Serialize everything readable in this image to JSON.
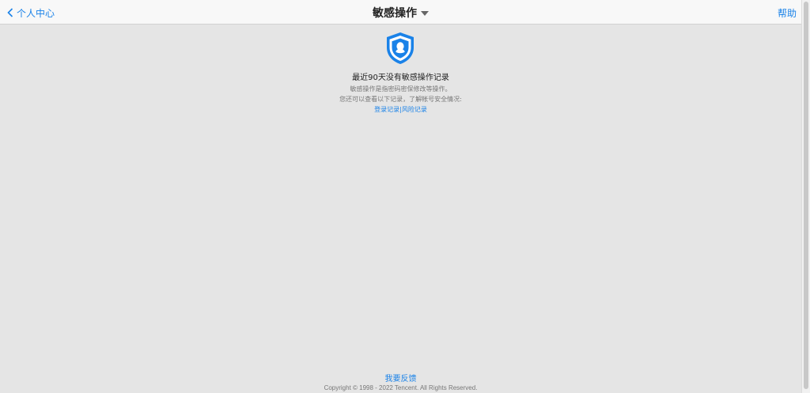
{
  "header": {
    "back_label": "个人中心",
    "title": "敏感操作",
    "help_label": "帮助"
  },
  "main": {
    "icon": "qq-shield-icon",
    "empty_title": "最近90天没有敏感操作记录",
    "desc_line1": "敏感操作是指密码密保修改等操作。",
    "desc_line2": "您还可以查看以下记录，了解帐号安全情况:",
    "link_login": "登录记录",
    "link_separator": "|",
    "link_risk": "风险记录"
  },
  "footer": {
    "feedback_label": "我要反馈",
    "copyright": "Copyright © 1998 - 2022 Tencent. All Rights Reserved."
  },
  "colors": {
    "accent": "#1a82e8",
    "background": "#e5e5e5",
    "topbar": "#f8f8f8"
  }
}
